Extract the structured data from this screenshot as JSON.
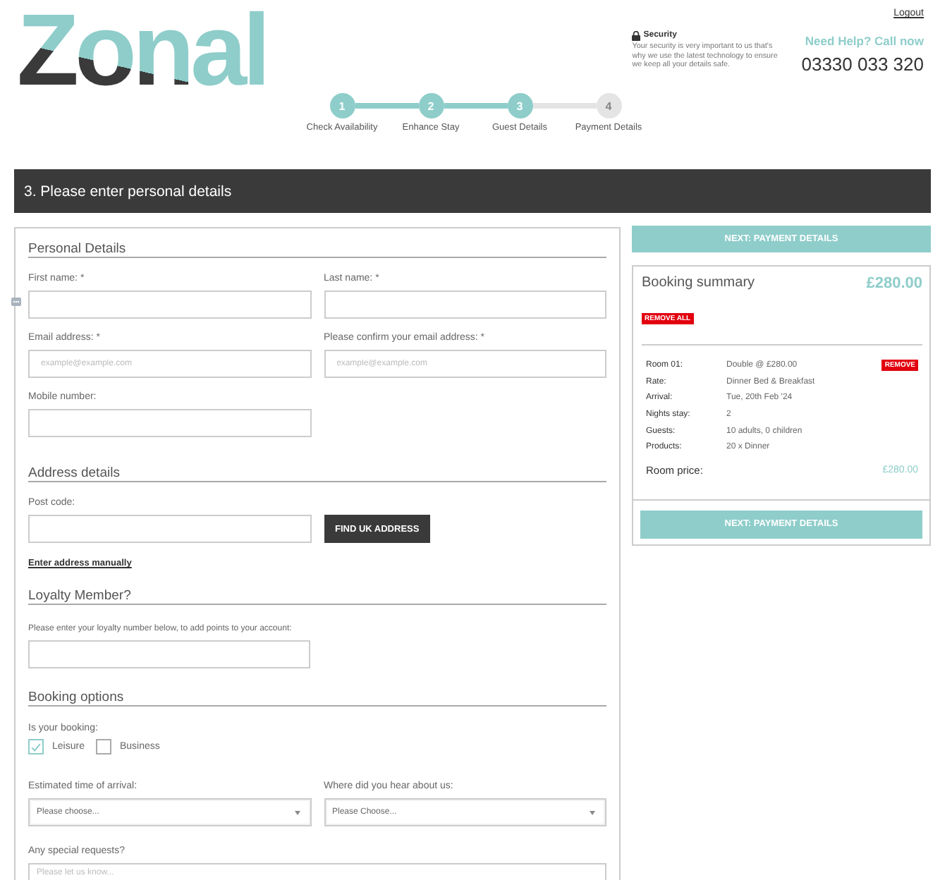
{
  "header": {
    "logo": "Zonal",
    "logout": "Logout",
    "security": {
      "title": "Security",
      "text": "Your security is very important to us that's why we use the latest technology to ensure we keep all your details safe."
    },
    "help": {
      "title": "Need Help? Call now",
      "phone": "03330 033 320"
    }
  },
  "steps": [
    {
      "number": "1",
      "label": "Check Availability",
      "reached": true
    },
    {
      "number": "2",
      "label": "Enhance Stay",
      "reached": true
    },
    {
      "number": "3",
      "label": "Guest Details",
      "reached": true
    },
    {
      "number": "4",
      "label": "Payment Details",
      "reached": false
    }
  ],
  "page_title": "3. Please enter personal details",
  "personal_details": {
    "heading": "Personal Details",
    "fields": [
      {
        "label": "First name: *"
      },
      {
        "label": "Last name: *"
      },
      {
        "label": "Email address: *",
        "placeholder": "example@example.com"
      },
      {
        "label": "Please confirm your email address: *",
        "placeholder": "example@example.com"
      },
      {
        "label": "Mobile number:"
      }
    ]
  },
  "address_details": {
    "heading": "Address details",
    "postcode": {
      "label": "Post code:"
    },
    "find_button": "FIND UK ADDRESS",
    "manual_link": "Enter address manually"
  },
  "loyalty": {
    "heading": "Loyalty Member?",
    "hint": "Please enter your loyalty number below, to add points to your account:"
  },
  "booking_options": {
    "heading": "Booking options",
    "booking_type": {
      "label": "Is your booking:",
      "options": [
        {
          "label": "Leisure",
          "checked": true
        },
        {
          "label": "Business",
          "checked": false
        }
      ]
    },
    "selects": [
      {
        "label": "Estimated time of arrival:",
        "value": "Please choose..."
      },
      {
        "label": "Where did you hear about us:",
        "value": "Please Choose..."
      }
    ],
    "special_requests": {
      "label": "Any special requests?",
      "placeholder": "Please let us know..."
    }
  },
  "summary": {
    "next_button": "NEXT: PAYMENT DETAILS",
    "title": "Booking summary",
    "total": "£280.00",
    "remove_all": "REMOVE ALL",
    "rooms": [
      {
        "remove": "REMOVE",
        "details": [
          {
            "label": "Room 01:",
            "value": "Double @ £280.00"
          },
          {
            "label": "Rate:",
            "value": "Dinner Bed & Breakfast"
          },
          {
            "label": "Arrival:",
            "value": "Tue, 20th Feb '24"
          },
          {
            "label": "Nights stay:",
            "value": "2"
          },
          {
            "label": "Guests:",
            "value": "10 adults, 0 children"
          },
          {
            "label": "Products:",
            "value": "20 x Dinner"
          }
        ],
        "price_label": "Room price:",
        "price": "£280.00"
      }
    ],
    "next_button_bottom": "NEXT: PAYMENT DETAILS"
  }
}
